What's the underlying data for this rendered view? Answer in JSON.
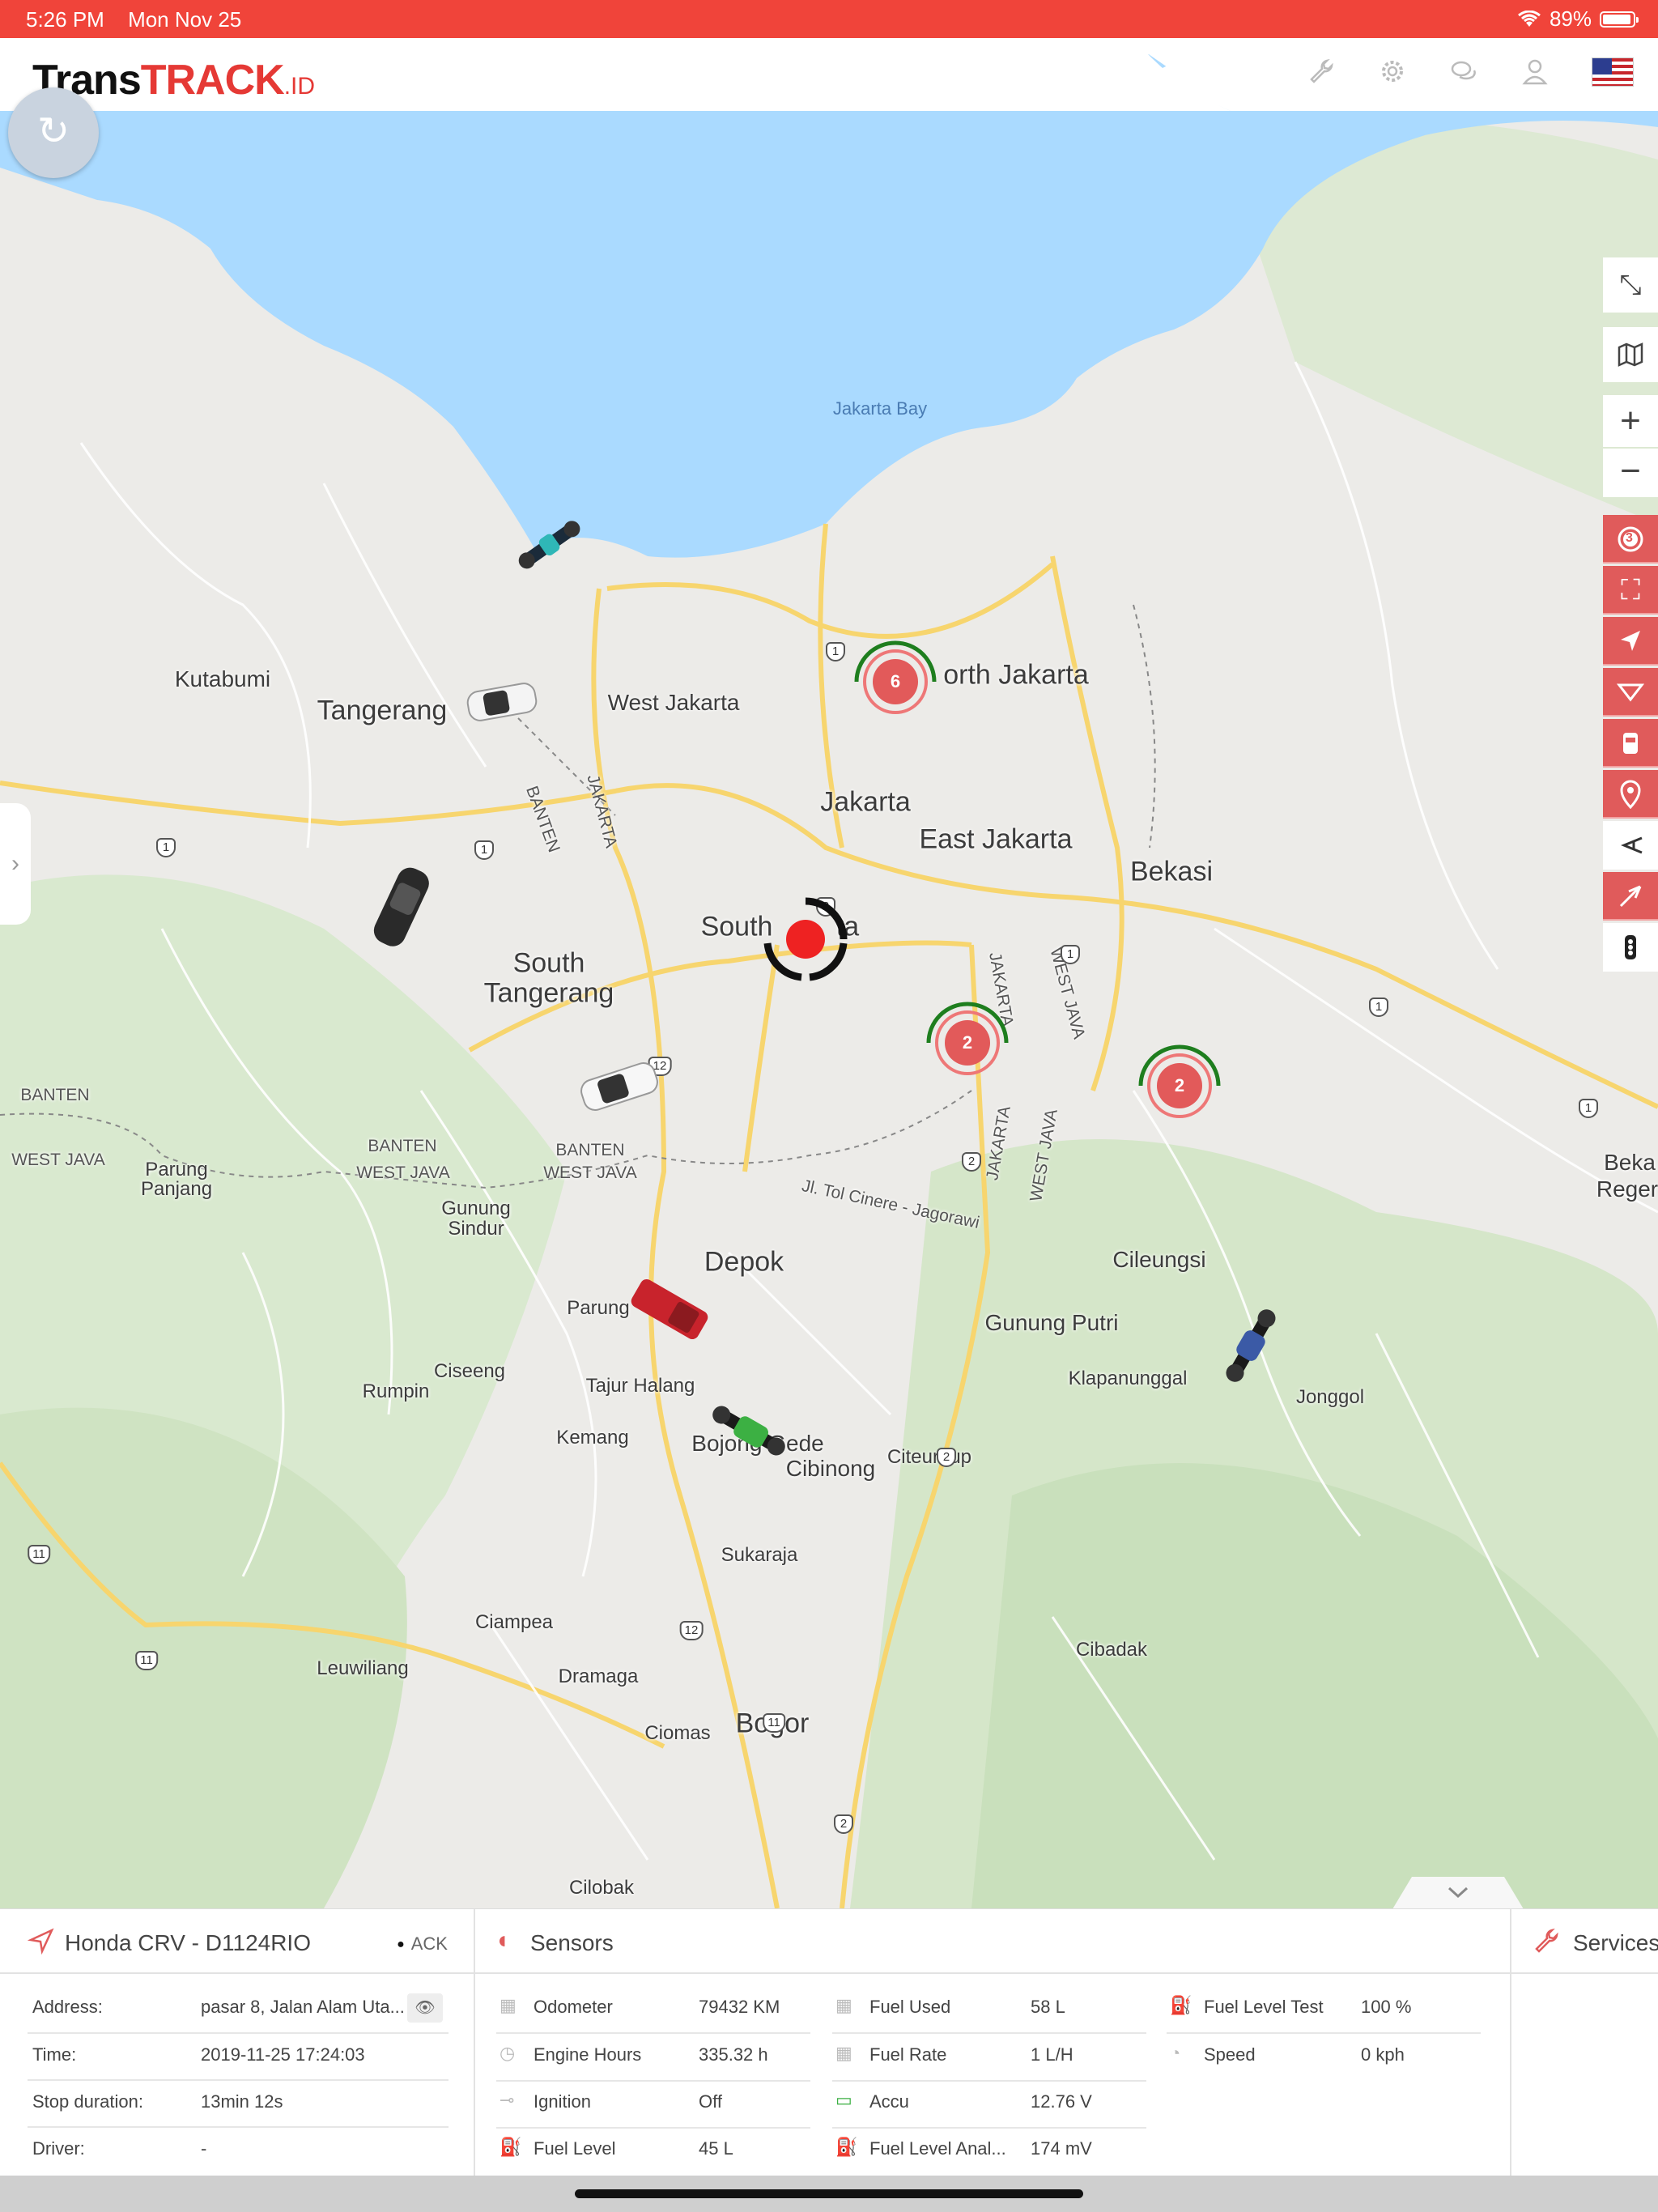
{
  "status_bar": {
    "time": "5:26 PM",
    "date": "Mon Nov 25",
    "battery": "89%"
  },
  "header": {
    "logo_prefix": "Trans",
    "logo_brand": "TRACK",
    "logo_tld": ".ID"
  },
  "map": {
    "water_label": "Jakarta Bay",
    "labels": {
      "kutabumi": "Kutabumi",
      "tangerang": "Tangerang",
      "west_jakarta": "West Jakarta",
      "north_jakarta": "orth Jakarta",
      "jakarta": "Jakarta",
      "east_jakarta": "East Jakarta",
      "bekasi": "Bekasi",
      "south_jakarta": "South",
      "south_jakarta_end": "ta",
      "south_tangerang_1": "South",
      "south_tangerang_2": "Tangerang",
      "banten_1": "BANTEN",
      "west_java_1": "WEST JAVA",
      "banten_2": "BANTEN",
      "west_java_2": "WEST JAVA",
      "banten_3": "BANTEN",
      "west_java_3": "WEST JAVA",
      "parung_panjang_1": "Parung",
      "parung_panjang_2": "Panjang",
      "gunung_sindur_1": "Gunung",
      "gunung_sindur_2": "Sindur",
      "depok": "Depok",
      "parung": "Parung",
      "ciseeng": "Ciseeng",
      "rumpin": "Rumpin",
      "tajur_halang": "Tajur Halang",
      "kemang": "Kemang",
      "bojong_gede": "Bojong Gede",
      "cibinong": "Cibinong",
      "citeureup": "Citeureup",
      "gunung_putri": "Gunung Putri",
      "klapanunggal": "Klapanunggal",
      "cileungsi": "Cileungsi",
      "jonggol": "Jonggol",
      "beka_1": "Beka",
      "beka_2": "Reger",
      "sukaraja": "Sukaraja",
      "ciampea": "Ciampea",
      "leuwiliang": "Leuwiliang",
      "dramaga": "Dramaga",
      "ciomas": "Ciomas",
      "bogor": "Bogor",
      "cibadak": "Cibadak",
      "cilobak": "Cilobak",
      "tol_cinere": "Jl. Tol Cinere - Jagorawi",
      "jakarta_road": "JAKARTA",
      "banten_road": "BANTEN",
      "west_java_road": "WEST JAVA",
      "jakarta_road_2": "JAKARTA",
      "west_java_road_2": "WEST JAVA",
      "jakarta_road_3": "JAKARTA"
    },
    "road_shields": [
      "1",
      "1",
      "1",
      "2",
      "1",
      "1",
      "1",
      "12",
      "2",
      "2",
      "11",
      "11",
      "12",
      "11",
      "2"
    ],
    "clusters": [
      {
        "count": "6"
      },
      {
        "count": "2"
      },
      {
        "count": "2"
      }
    ]
  },
  "toolbar": {
    "badge_count": "3",
    "icons": [
      "fullscreen-icon",
      "map-layers-icon",
      "zoom-in-icon",
      "zoom-out-icon",
      "alarm-icon",
      "fit-bounds-icon",
      "navigate-icon",
      "filter-icon",
      "vehicle-icon",
      "location-pin-icon",
      "route-icon",
      "send-icon",
      "more-icon"
    ]
  },
  "vehicle_panel": {
    "title": "Honda CRV - D1124RIO",
    "ack": "ACK",
    "rows": [
      {
        "label": "Address:",
        "value": "pasar 8, Jalan Alam Uta..."
      },
      {
        "label": "Time:",
        "value": "2019-11-25 17:24:03"
      },
      {
        "label": "Stop duration:",
        "value": "13min 12s"
      },
      {
        "label": "Driver:",
        "value": "-"
      }
    ]
  },
  "sensors": {
    "title": "Sensors",
    "col1": [
      {
        "label": "Odometer",
        "value": "79432 KM"
      },
      {
        "label": "Engine Hours",
        "value": "335.32 h"
      },
      {
        "label": "Ignition",
        "value": "Off"
      },
      {
        "label": "Fuel Level",
        "value": "45 L"
      }
    ],
    "col2": [
      {
        "label": "Fuel Used",
        "value": "58 L"
      },
      {
        "label": "Fuel Rate",
        "value": "1 L/H"
      },
      {
        "label": "Accu",
        "value": "12.76 V"
      },
      {
        "label": "Fuel Level Anal...",
        "value": "174 mV"
      }
    ],
    "col3": [
      {
        "label": "Fuel Level Test",
        "value": "100 %"
      },
      {
        "label": "Speed",
        "value": "0 kph"
      }
    ]
  },
  "services": {
    "title": "Services"
  }
}
